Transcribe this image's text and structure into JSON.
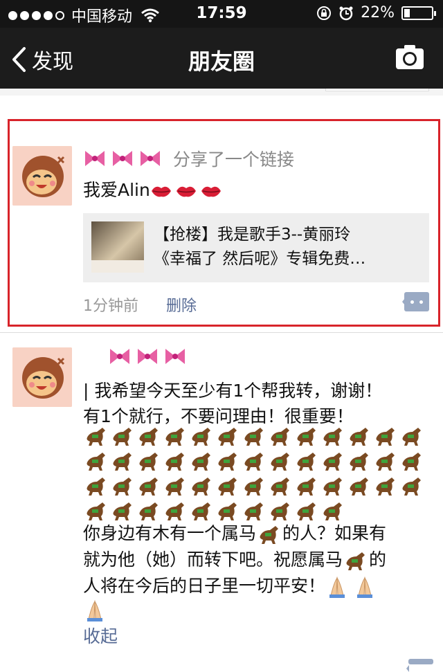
{
  "status_bar": {
    "carrier": "中国移动",
    "time": "17:59",
    "battery": "22%",
    "battery_level": 0.22
  },
  "nav": {
    "back_label": "发现",
    "title": "朋友圈",
    "camera_icon": "camera-icon"
  },
  "posts": [
    {
      "action": "分享了一个链接",
      "text": "我爱Alin",
      "link": {
        "line1": "【抢楼】我是歌手3--黄丽玲",
        "line2": "《幸福了 然后呢》专辑免费…"
      },
      "time": "1分钟前",
      "delete_label": "删除"
    },
    {
      "text_line1": "| 我希望今天至少有1个帮我转，谢谢！",
      "text_line2": "有1个就行，不要问理由！很重要！",
      "horse_count": 49,
      "text_line3a": "你身边有木有一个属马",
      "text_line3b": "的人？如果有",
      "text_line4a": "就为他（她）而转下吧。祝愿属马",
      "text_line4b": "的",
      "text_line5": "人将在今后的日子里一切平安！",
      "collapse_label": "收起"
    }
  ],
  "colors": {
    "nav_bg": "#1c1c1c",
    "link_blue": "#576b95",
    "highlight_red": "#d8232a",
    "gray_text": "#888888"
  }
}
